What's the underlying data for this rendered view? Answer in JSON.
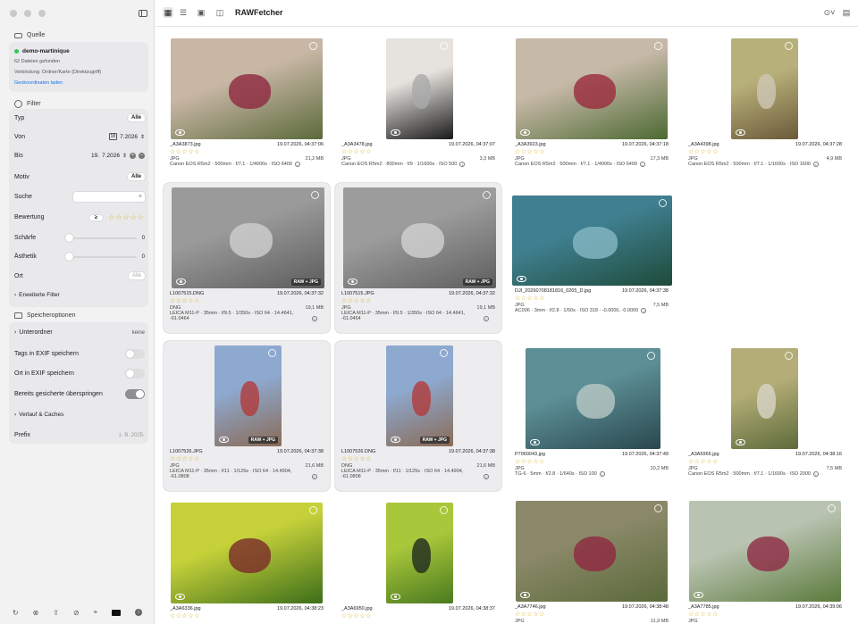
{
  "window": {
    "title": "RAWFetcher"
  },
  "sidebar": {
    "quelle": {
      "title": "Quelle",
      "source_name": "demo-martinique",
      "status_color": "#34c759",
      "file_count": "62 Dateien gefunden",
      "connection": "Verbindung: Ordner/Karte (Direktzugriff)",
      "geo_link": "Geokoordinaten laden"
    },
    "filter": {
      "title": "Filter",
      "typ": {
        "label": "Typ",
        "value": "Alle"
      },
      "von": {
        "label": "Von",
        "value": "7.2026",
        "day": "18"
      },
      "bis": {
        "label": "Bis",
        "day": "19.",
        "value": "7.2026"
      },
      "motiv": {
        "label": "Motiv",
        "value": "Alle"
      },
      "suche": {
        "label": "Suche",
        "placeholder": ""
      },
      "bewertung": {
        "label": "Bewertung",
        "op": "≥",
        "stars": "☆☆☆☆☆"
      },
      "schaerfe": {
        "label": "Schärfe",
        "value": "0"
      },
      "aesthetik": {
        "label": "Ästhetik",
        "value": "0"
      },
      "ort": {
        "label": "Ort",
        "value": "Alle"
      },
      "erweitert": "Erweiterte Filter"
    },
    "speicher": {
      "title": "Speicheroptionen",
      "unterordner": {
        "label": "Unterordner",
        "value": "keine"
      },
      "tags_exif": {
        "label": "Tags in EXIF speichern",
        "on": false
      },
      "ort_exif": {
        "label": "Ort in EXIF speichern",
        "on": false
      },
      "skip": {
        "label": "Bereits gesicherte überspringen",
        "on": true
      },
      "verlauf": "Verlauf & Caches",
      "prefix": {
        "label": "Prefix",
        "placeholder": "z. B. 2025-"
      }
    },
    "bottom_icons": [
      "refresh-icon",
      "stop-icon",
      "upload-icon",
      "no-entry-icon",
      "crosshair-icon",
      "color-swatch-icon",
      "info-icon"
    ]
  },
  "toolbar": {
    "icons": [
      "grid-view-icon",
      "list-view-icon",
      "gallery-icon",
      "camera-icon"
    ],
    "right_icons": [
      "check-circle-icon",
      "chat-icon"
    ]
  },
  "photos": [
    {
      "name": "_A3A3873.jpg",
      "date": "19.07.2026, 04:37:06",
      "type": "JPG",
      "size": "21,2 MB",
      "exif": "Canon EOS R5m2 · 500mm · f/7.1 · 1/4000s · ISO 6400",
      "exif2": "",
      "badge": ""
    },
    {
      "name": "_A3A3478.jpg",
      "date": "19.07.2026, 04:37:07",
      "type": "JPG",
      "size": "3,3 MB",
      "exif": "Canon EOS R5m2 · 800mm · f/9 · 1/1600s · ISO 500",
      "exif2": "",
      "badge": ""
    },
    {
      "name": "_A3A3923.jpg",
      "date": "19.07.2026, 04:37:18",
      "type": "JPG",
      "size": "17,3 MB",
      "exif": "Canon EOS R5m2 · 500mm · f/7.1 · 1/4000s · ISO 6400",
      "exif2": "",
      "badge": ""
    },
    {
      "name": "_A3A4398.jpg",
      "date": "19.07.2026, 04:37:28",
      "type": "JPG",
      "size": "4,9 MB",
      "exif": "Canon EOS R5m2 · 500mm · f/7.1 · 1/1600s · ISO 1600",
      "exif2": "",
      "badge": ""
    },
    {
      "name": "L1007515.DNG",
      "date": "19.07.2026, 04:37:32",
      "type": "DNG",
      "size": "19,1 MB",
      "exif": "LEICA M11-P · 35mm · f/9.5 · 1/350s · ISO 64 · 14.4641,",
      "exif2": "-61.0464",
      "badge": "RAW + JPG"
    },
    {
      "name": "L1007515.JPG",
      "date": "19.07.2026, 04:37:32",
      "type": "JPG",
      "size": "19,1 MB",
      "exif": "LEICA M11-P · 35mm · f/9.5 · 1/350s · ISO 64 · 14.4641,",
      "exif2": "-61.0464",
      "badge": "RAW + JPG"
    },
    {
      "name": "DJI_20260708181816_0265_D.jpg",
      "date": "19.07.2026, 04:37:38",
      "type": "JPG",
      "size": "7,5 MB",
      "exif": "AC006 · 3mm · f/2.8 · 1/50s · ISO 318 · -0.0000, -0.0000",
      "exif2": "",
      "badge": ""
    },
    {
      "name": "L1007526.JPG",
      "date": "19.07.2026, 04:37:38",
      "type": "JPG",
      "size": "21,6 MB",
      "exif": "LEICA M11-P · 35mm · f/11 · 1/125s · ISO 64 · 14.4904,",
      "exif2": "-61.0808",
      "badge": "RAW + JPG"
    },
    {
      "name": "L1007526.DNG",
      "date": "19.07.2026, 04:37:38",
      "type": "DNG",
      "size": "21,6 MB",
      "exif": "LEICA M11-P · 35mm · f/11 · 1/125s · ISO 64 · 14.4904,",
      "exif2": "-61.0808",
      "badge": "RAW + JPG"
    },
    {
      "name": "P7060043.jpg",
      "date": "19.07.2026, 04:37:49",
      "type": "JPG",
      "size": "10,2 MB",
      "exif": "TG-6 · 5mm · f/2.8 · 1/640s · ISO 100",
      "exif2": "",
      "badge": ""
    },
    {
      "name": "_A3A5965.jpg",
      "date": "19.07.2026, 04:38:16",
      "type": "JPG",
      "size": "7,5 MB",
      "exif": "Canon EOS R5m2 · 500mm · f/7.1 · 1/1600s · ISO 2000",
      "exif2": "",
      "badge": ""
    },
    {
      "name": "_A3A6336.jpg",
      "date": "19.07.2026, 04:38:23",
      "type": "",
      "size": "",
      "exif": "",
      "exif2": "",
      "badge": ""
    },
    {
      "name": "_A3A6950.jpg",
      "date": "19.07.2026, 04:38:37",
      "type": "",
      "size": "",
      "exif": "",
      "exif2": "",
      "badge": ""
    },
    {
      "name": "_A3A7746.jpg",
      "date": "19.07.2026, 04:38:48",
      "type": "JPG",
      "size": "11,9 MB",
      "exif": "",
      "exif2": "",
      "badge": ""
    },
    {
      "name": "_A3A7785.jpg",
      "date": "19.07.2026, 04:39:06",
      "type": "JPG",
      "size": "",
      "exif": "",
      "exif2": "",
      "badge": ""
    }
  ],
  "stars_empty": "☆☆☆☆☆"
}
